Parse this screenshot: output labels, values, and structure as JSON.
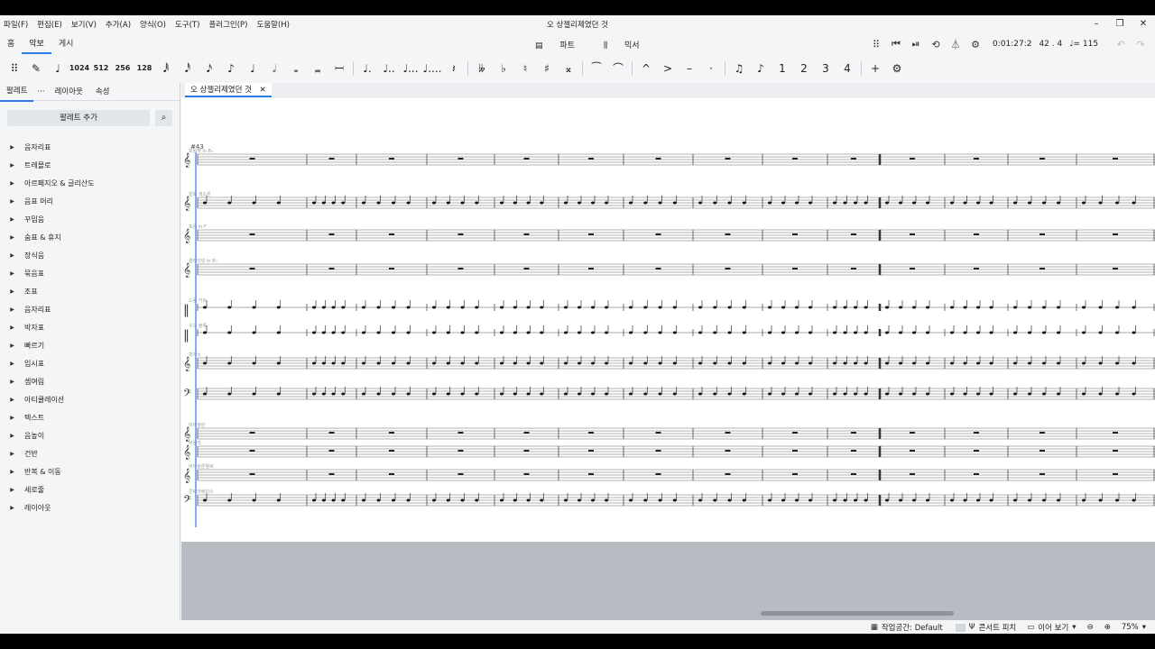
{
  "window": {
    "title": "오 상젤리제였던 것",
    "menu": [
      "파일(F)",
      "편집(E)",
      "보기(V)",
      "추가(A)",
      "양식(O)",
      "도구(T)",
      "플러그인(P)",
      "도움말(H)"
    ],
    "controls": {
      "minimize": "–",
      "maximize": "❐",
      "close": "✕"
    }
  },
  "tabs": {
    "home": "홈",
    "score": "악보",
    "publish": "게시"
  },
  "center_tabs": {
    "parts": "파트",
    "mixer": "믹서"
  },
  "playback": {
    "time": "0:01:27:2",
    "position": "42 . 4",
    "tempo": "♩= 115"
  },
  "note_toolbar": {
    "durations": [
      "1024",
      "512",
      "256",
      "128"
    ],
    "duration_glyphs": [
      "𝅘𝅥𝅱",
      "𝅘𝅥𝅰",
      "𝅘𝅥𝅯",
      "♪",
      "♩",
      "𝅗𝅥",
      "𝅝",
      "𝅜",
      "𝄩"
    ]
  },
  "palette_panel": {
    "tabs": [
      "팔레트",
      "레이아웃",
      "속성"
    ],
    "add_button": "팔레트 추가",
    "items": [
      "음자리표",
      "트레몰로",
      "아르페지오 & 글리산도",
      "음표 머리",
      "꾸밈음",
      "숨표 & 휴지",
      "장식음",
      "묶음표",
      "조표",
      "음자리표",
      "박자표",
      "빠르기",
      "임시표",
      "셈여림",
      "아티큘레이션",
      "텍스트",
      "음높이",
      "건반",
      "반복 & 이동",
      "세로줄",
      "레이아웃"
    ]
  },
  "document": {
    "tab_title": "오 상젤리제였던 것",
    "measure_number": "#43"
  },
  "staves": [
    {
      "label": "트럼펫 in B♭",
      "y": 0
    },
    {
      "label": "알토 색소폰",
      "y": 0
    },
    {
      "label": "호른 in F",
      "y": 0
    },
    {
      "label": "클라리넷 in B♭",
      "y": 0
    },
    {
      "label": "드럼 키트",
      "y": 0
    },
    {
      "label": "우드 블록",
      "y": 0
    },
    {
      "label": "피아노",
      "y": 0
    },
    {
      "label": "",
      "y": 0
    },
    {
      "label": "바이올린",
      "y": 0
    },
    {
      "label": "비올라",
      "y": 0
    },
    {
      "label": "바이올론첼로",
      "y": 0
    },
    {
      "label": "콘트라베이스",
      "y": 0
    }
  ],
  "status": {
    "workspace": "작업공간: Default",
    "concert_pitch": "콘서트 피치",
    "view_mode": "이어 보기",
    "zoom": "75%"
  }
}
